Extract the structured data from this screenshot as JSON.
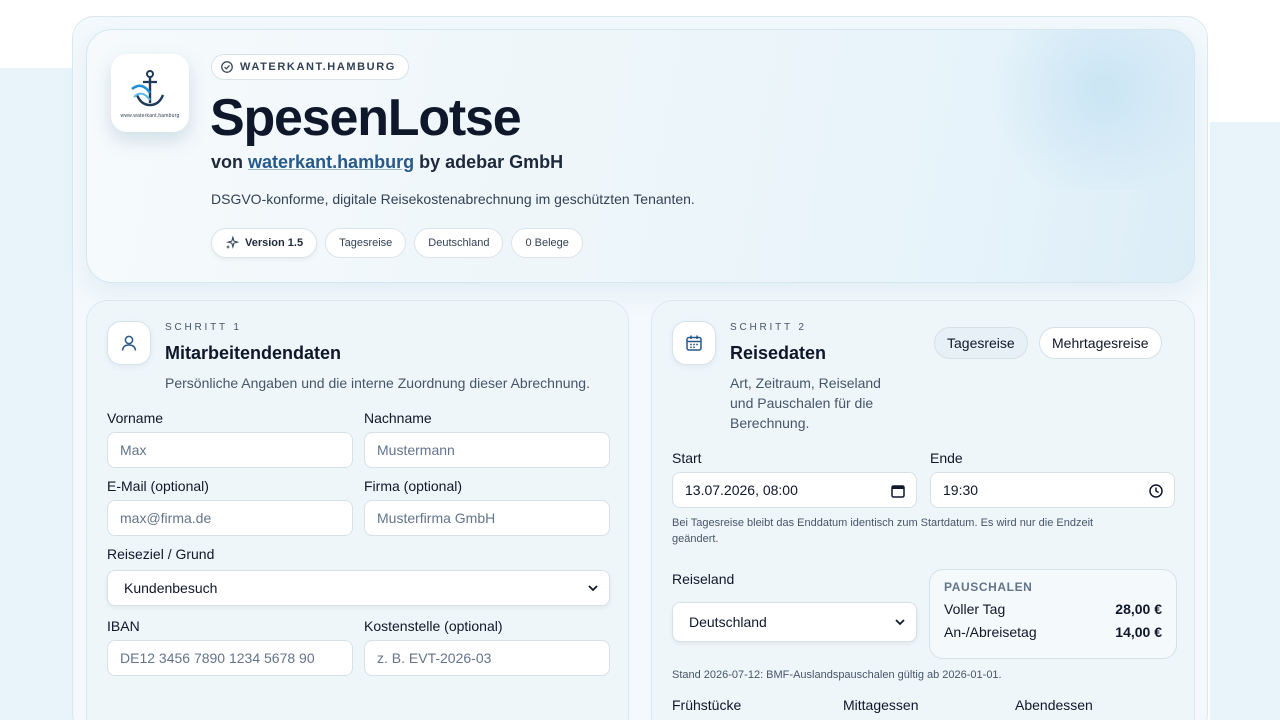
{
  "hero": {
    "logo_caption": "www.waterkant.hamburg",
    "brand_badge": "WATERKANT.HAMBURG",
    "title": "SpesenLotse",
    "subtitle_prefix": "von",
    "subtitle_link": "waterkant.hamburg",
    "subtitle_suffix": "by adebar GmbH",
    "description": "DSGVO-konforme, digitale Reisekostenabrechnung im geschützten Tenanten.",
    "chips": [
      "Version 1.5",
      "Tagesreise",
      "Deutschland",
      "0 Belege"
    ]
  },
  "step1": {
    "label": "SCHRITT 1",
    "title": "Mitarbeitendendaten",
    "description": "Persönliche Angaben und die interne Zuordnung dieser Abrechnung.",
    "fields": {
      "vorname": {
        "label": "Vorname",
        "placeholder": "Max"
      },
      "nachname": {
        "label": "Nachname",
        "placeholder": "Mustermann"
      },
      "email": {
        "label": "E-Mail (optional)",
        "placeholder": "max@firma.de"
      },
      "firma": {
        "label": "Firma (optional)",
        "placeholder": "Musterfirma GmbH"
      },
      "reiseziel": {
        "label": "Reiseziel / Grund",
        "value": "Kundenbesuch"
      },
      "iban": {
        "label": "IBAN",
        "placeholder": "DE12 3456 7890 1234 5678 90"
      },
      "kostenstelle": {
        "label": "Kostenstelle (optional)",
        "placeholder": "z. B. EVT-2026-03"
      }
    }
  },
  "step2": {
    "label": "SCHRITT 2",
    "title": "Reisedaten",
    "description_lines": [
      "Art, Zeitraum, Reiseland",
      "und Pauschalen für die",
      "Berechnung."
    ],
    "trip_types": [
      "Tagesreise",
      "Mehrtagesreise"
    ],
    "start": {
      "label": "Start",
      "value": "13.07.2026, 08:00"
    },
    "ende": {
      "label": "Ende",
      "value": "19:30"
    },
    "hint_lines": [
      "Bei Tagesreise bleibt das Enddatum identisch zum Startdatum. Es wird nur die Endzeit",
      "geändert."
    ],
    "reiseland": {
      "label": "Reiseland",
      "value": "Deutschland"
    },
    "pauschalen": {
      "title": "PAUSCHALEN",
      "rows": [
        {
          "label": "Voller Tag",
          "value": "28,00 €"
        },
        {
          "label": "An-/Abreisetag",
          "value": "14,00 €"
        }
      ]
    },
    "stand": "Stand 2026-07-12: BMF-Auslandspauschalen gültig ab 2026-01-01.",
    "meals": [
      "Frühstücke",
      "Mittagessen",
      "Abendessen"
    ]
  },
  "colors": {
    "accent": "#27598a",
    "panel": "#eef6fa"
  }
}
